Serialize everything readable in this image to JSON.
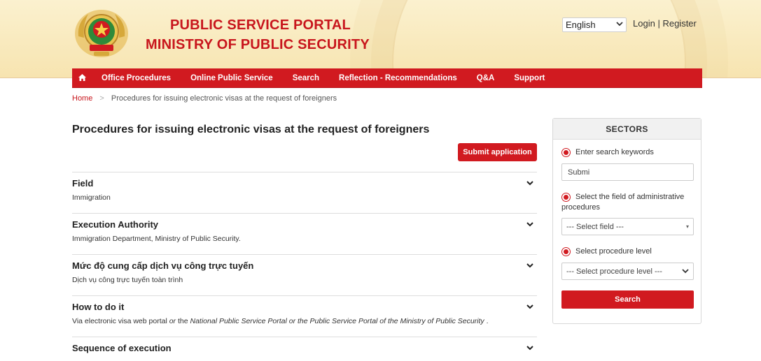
{
  "header": {
    "title_line1": "PUBLIC SERVICE PORTAL",
    "title_line2": "MINISTRY OF PUBLIC SECURITY",
    "language": "English",
    "login": "Login",
    "separator": "|",
    "register": "Register",
    "colors": {
      "brand_red": "#c8161d",
      "header_bg": "#f9eac2"
    }
  },
  "nav": {
    "home_icon": "home-icon",
    "items": [
      "Office Procedures",
      "Online Public Service",
      "Search",
      "Reflection - Recommendations",
      "Q&A",
      "Support"
    ]
  },
  "breadcrumb": {
    "home": "Home",
    "separator": ">",
    "current": "Procedures for issuing electronic visas at the request of foreigners"
  },
  "main": {
    "title": "Procedures for issuing electronic visas at the request of foreigners",
    "submit_label": "Submit application",
    "sections": [
      {
        "heading": "Field",
        "body": "Immigration"
      },
      {
        "heading": "Execution Authority",
        "body": "Immigration Department, Ministry of Public Security."
      },
      {
        "heading": "Mức độ cung cấp dịch vụ công trực tuyến",
        "body": "Dịch vụ công trực tuyến toàn trình"
      },
      {
        "heading": "How to do it",
        "body_part1": "Via electronic visa web portal ",
        "body_part2": "or",
        "body_part3": " the ",
        "body_part4": "National Public Service Portal or the Public Service Portal of the Ministry of Public Security",
        "body_part5": " ."
      },
      {
        "heading": "Sequence of execution",
        "body": ""
      }
    ]
  },
  "sidebar": {
    "title": "SECTORS",
    "keyword_label": "Enter search keywords",
    "keyword_value": "Submi",
    "field_label": "Select the field of administrative procedures",
    "field_value": "--- Select field ---",
    "level_label": "Select procedure level",
    "level_value": "--- Select procedure level ---",
    "search_label": "Search"
  }
}
